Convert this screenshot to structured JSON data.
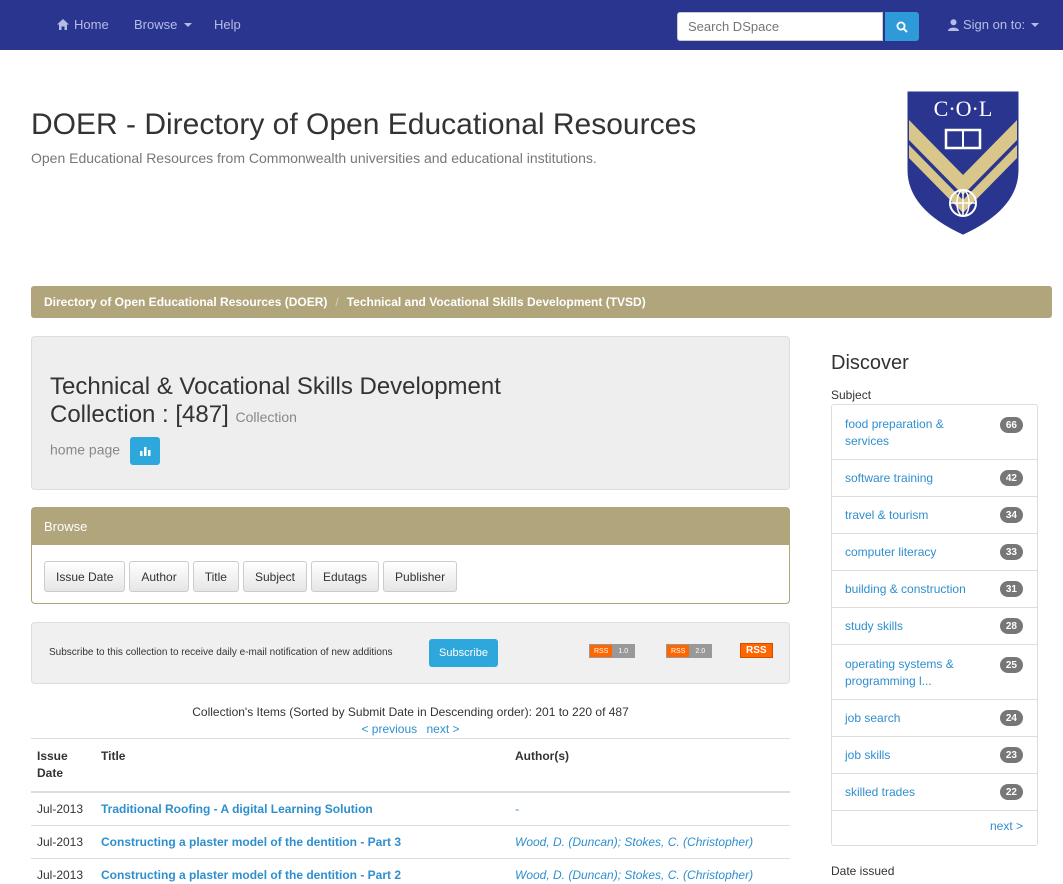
{
  "navbar": {
    "home": "Home",
    "browse": "Browse",
    "help": "Help",
    "search_placeholder": "Search DSpace",
    "signin": "Sign on to:"
  },
  "header": {
    "title": "DOER - Directory of Open Educational Resources",
    "subtitle": "Open Educational Resources from Commonwealth universities and educational institutions.",
    "logo_text": "C·O·L"
  },
  "breadcrumb": {
    "items": [
      "Directory of Open Educational Resources (DOER)",
      "Technical and Vocational Skills Development (TVSD)"
    ],
    "separator": "/"
  },
  "collection": {
    "title": "Technical & Vocational Skills Development Collection : [487]",
    "subtitle_part1": "Collection",
    "subtitle_part2": "home page"
  },
  "browse": {
    "heading": "Browse",
    "buttons": [
      "Issue Date",
      "Author",
      "Title",
      "Subject",
      "Edutags",
      "Publisher"
    ]
  },
  "subscribe": {
    "text": "Subscribe to this collection to receive daily e-mail notification of new additions",
    "button": "Subscribe",
    "rss1_left": "RSS",
    "rss1_right": "1.0",
    "rss2_left": "RSS",
    "rss2_right": "2.0",
    "rss3": "RSS"
  },
  "items": {
    "caption": "Collection's Items (Sorted by Submit Date in Descending order): 201 to 220 of 487",
    "prev": "< previous",
    "next": "next >",
    "headers": {
      "date_line1": "Issue",
      "date_line2": "Date",
      "title": "Title",
      "author": "Author(s)"
    },
    "rows": [
      {
        "date": "Jul-2013",
        "title": "Traditional Roofing - A digital Learning Solution",
        "author": "-"
      },
      {
        "date": "Jul-2013",
        "title": "Constructing a plaster model of the dentition - Part 3",
        "author": "Wood, D. (Duncan); Stokes, C. (Christopher)"
      },
      {
        "date": "Jul-2013",
        "title": "Constructing a plaster model of the dentition - Part 2",
        "author": "Wood, D. (Duncan); Stokes, C. (Christopher)"
      }
    ]
  },
  "discover": {
    "title": "Discover",
    "subject_label": "Subject",
    "facets": [
      {
        "label": "food preparation & services",
        "count": "66"
      },
      {
        "label": "software training",
        "count": "42"
      },
      {
        "label": "travel & tourism",
        "count": "34"
      },
      {
        "label": "computer literacy",
        "count": "33"
      },
      {
        "label": "building & construction",
        "count": "31"
      },
      {
        "label": "study skills",
        "count": "28"
      },
      {
        "label": "operating systems & programming l...",
        "count": "25"
      },
      {
        "label": "job search",
        "count": "24"
      },
      {
        "label": "job skills",
        "count": "23"
      },
      {
        "label": "skilled trades",
        "count": "22"
      }
    ],
    "next": "next >",
    "date_label": "Date issued"
  }
}
